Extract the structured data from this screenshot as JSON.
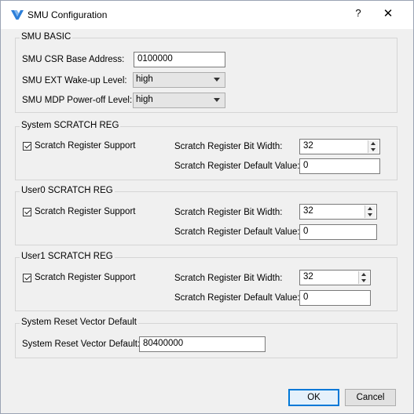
{
  "window": {
    "title": "SMU Configuration",
    "help": "?",
    "close": "✕"
  },
  "basic": {
    "title": "SMU BASIC",
    "csr_label": "SMU CSR Base Address:",
    "csr_value": "0100000",
    "ext_label": "SMU EXT Wake-up Level:",
    "ext_value": "high",
    "mdp_label": "SMU MDP Power-off Level:",
    "mdp_value": "high"
  },
  "system_scratch": {
    "title": "System SCRATCH REG",
    "support_label": "Scratch Register Support",
    "width_label": "Scratch Register Bit Width:",
    "width_value": "32",
    "default_label": "Scratch Register Default Value:",
    "default_value": "0"
  },
  "user0_scratch": {
    "title": "User0 SCRATCH REG",
    "support_label": "Scratch Register Support",
    "width_label": "Scratch Register Bit Width:",
    "width_value": "32",
    "default_label": "Scratch Register Default Value:",
    "default_value": "0"
  },
  "user1_scratch": {
    "title": "User1 SCRATCH REG",
    "support_label": "Scratch Register Support",
    "width_label": "Scratch Register Bit Width:",
    "width_value": "32",
    "default_label": "Scratch Register Default Value:",
    "default_value": "0"
  },
  "reset": {
    "title": "System Reset Vector Default",
    "label": "System Reset Vector Default:",
    "value": "80400000"
  },
  "buttons": {
    "ok": "OK",
    "cancel": "Cancel"
  }
}
